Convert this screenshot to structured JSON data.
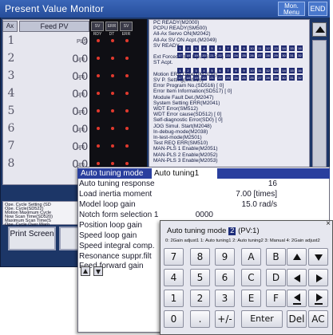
{
  "monitor": {
    "title": "Present Value Monitor",
    "mon_menu": "Mon. Menu",
    "end": "END",
    "header_ax": "Ax",
    "header_feed": "Feed PV",
    "led_headers": [
      "SV RDY",
      "ERR DT",
      "SV ERR"
    ],
    "rows": [
      {
        "idx": "1",
        "value": "0",
        "unit": "PLS"
      },
      {
        "idx": "2",
        "value": "0.0",
        "unit": "μm"
      },
      {
        "idx": "3",
        "value": "0.0",
        "unit": "μm"
      },
      {
        "idx": "4",
        "value": "0.0",
        "unit": "μm"
      },
      {
        "idx": "5",
        "value": "0.0",
        "unit": "μm"
      },
      {
        "idx": "6",
        "value": "0.0",
        "unit": "μm"
      },
      {
        "idx": "7",
        "value": "0.0",
        "unit": "μm"
      },
      {
        "idx": "8",
        "value": "0.0",
        "unit": "μm"
      }
    ],
    "status_lines": [
      "PC READY(M2000)",
      "PCPU READY(SM500)",
      "All-Ax Servo ON(M2042)",
      "All-Ax SV ON Acpt.(M2049)",
      "SV READY",
      "",
      "Ext Forced Stop Input(SM502)",
      "ST Acpt.",
      "",
      "Motion ERR Detect(M2039)",
      "SV P. Setting(SM516)",
      "  Error Program No.(SD516) [    0]",
      "  Error Item Information(SD517) [    0]",
      "Module Fault Det.(M2047)",
      "System Setting ERR(M2041)",
      "WDT Error(SM512)",
      "WDT Error cause(SD512) [    0]",
      "Self-diagnostic Error(SD0) [    0]",
      "JOG Simul. Start(M2048)",
      "In-debug-mode(M2038)",
      "In-test-mode(M2501)",
      "Test REQ ERR(SM510)",
      "MAN-PLS 1 Enable(M2051)",
      "MAN-PLS 2 Enable(M2052)",
      "MAN-PLS 3 Enable(M2053)"
    ],
    "bits_row1": [
      "1",
      "2",
      "3",
      "4",
      "5",
      "6",
      "7",
      "8",
      "9",
      "10",
      "11",
      "12",
      "13",
      "14",
      "15",
      "16"
    ],
    "bits_row2": [
      "17",
      "18",
      "19",
      "20",
      "21",
      "22",
      "23",
      "24",
      "25",
      "26",
      "27",
      "28",
      "29",
      "30",
      "31",
      "32"
    ],
    "mini_list": [
      "Ope. Cycle Setting (SD",
      "Ope. Cycle(SD522)",
      "Motion Maximum Cycle",
      "Now Scan Time(SD520)",
      "Maximum Scan Time(S",
      "Ope. Cycle Over Warn"
    ],
    "print_label": "Print Screen"
  },
  "params": [
    {
      "label": "Auto tuning mode",
      "value": "Auto tuning1"
    },
    {
      "label": "Auto tuning response",
      "value": "16"
    },
    {
      "label": "Load inertia moment",
      "value": "7.00 [times]"
    },
    {
      "label": "Model loop gain",
      "value": "15.0 rad/s"
    },
    {
      "label": "Notch form selection 1",
      "value": "0000"
    },
    {
      "label": "Position loop gain",
      "value": ""
    },
    {
      "label": "Speed loop gain",
      "value": ""
    },
    {
      "label": "Speed integral comp.",
      "value": ""
    },
    {
      "label": "Resonance suppr.filt",
      "value": ""
    },
    {
      "label": "Feed forward gain",
      "value": ""
    }
  ],
  "keypad": {
    "close": "×",
    "title_prefix": "Auto tuning mode",
    "title_selected": "2",
    "title_suffix": "(PV:1)",
    "options": "0: 2Gain adjust1  1: Auto tuning1  2: Auto tuning2  3: Manual  4: 2Gain adjust2",
    "keys": {
      "k7": "7",
      "k8": "8",
      "k9": "9",
      "kA": "A",
      "kB": "B",
      "k4": "4",
      "k5": "5",
      "k6": "6",
      "kC": "C",
      "kD": "D",
      "k1": "1",
      "k2": "2",
      "k3": "3",
      "kE": "E",
      "kF": "F",
      "k0": "0",
      "kdot": ".",
      "kpm": "+/-",
      "enter": "Enter",
      "del": "Del",
      "ac": "AC"
    }
  },
  "colors": {
    "monitor_bg": "#1c3667",
    "title_bar": "#2c56a4",
    "led_red": "#e23a2e",
    "led_green": "#38d24a",
    "bit_blue": "#202a70",
    "selection": "#2a3f9e"
  },
  "icons": {
    "up": "triangle-up-icon",
    "down": "triangle-down-icon",
    "left": "triangle-left-icon",
    "right": "triangle-right-icon",
    "close": "close-icon"
  }
}
